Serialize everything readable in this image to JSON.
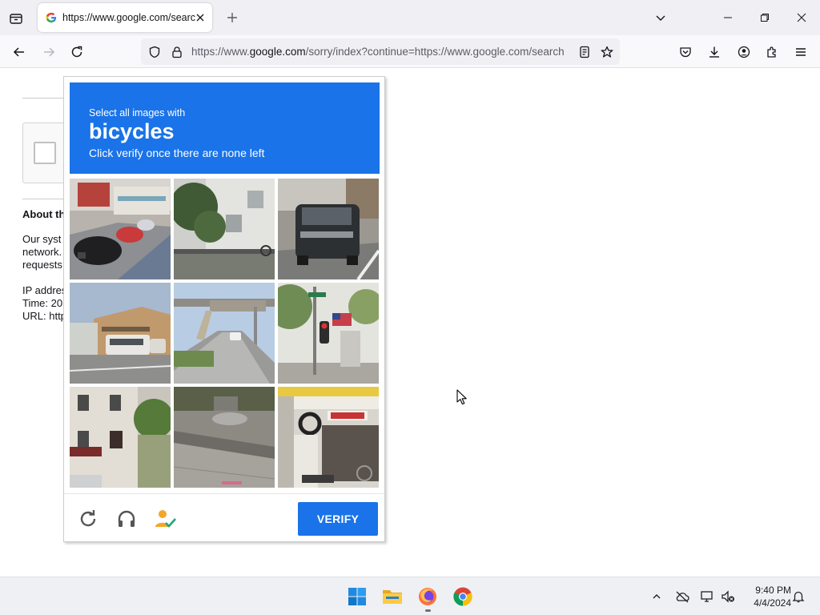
{
  "browser": {
    "tab": {
      "title": "https://www.google.com/search"
    },
    "url": {
      "prefix": "https://www.",
      "host": "google.com",
      "path": "/sorry/index?continue=https://www.google.com/search"
    }
  },
  "page": {
    "about_title": "About th",
    "about_lines": [
      "Our syst",
      "network.",
      "requests"
    ],
    "ip_line": "IP addres",
    "time_line": "Time: 20",
    "url_line": "URL: http"
  },
  "captcha": {
    "instruction": "Select all images with",
    "keyword": "bicycles",
    "hint": "Click verify once there are none left",
    "verify_label": "VERIFY",
    "tiles": [
      {
        "name": "tile-street-parked-cars"
      },
      {
        "name": "tile-house-with-tree"
      },
      {
        "name": "tile-dark-suv"
      },
      {
        "name": "tile-bus-by-building"
      },
      {
        "name": "tile-road-pedestrian-bridge"
      },
      {
        "name": "tile-traffic-light-flag"
      },
      {
        "name": "tile-townhouse"
      },
      {
        "name": "tile-sidewalk-debris"
      },
      {
        "name": "tile-tire-shop"
      }
    ]
  },
  "taskbar": {
    "time": "9:40 PM",
    "date": "4/4/2024"
  },
  "colors": {
    "accent": "#1a73e8",
    "chrome_bg": "#f0f0f4"
  }
}
